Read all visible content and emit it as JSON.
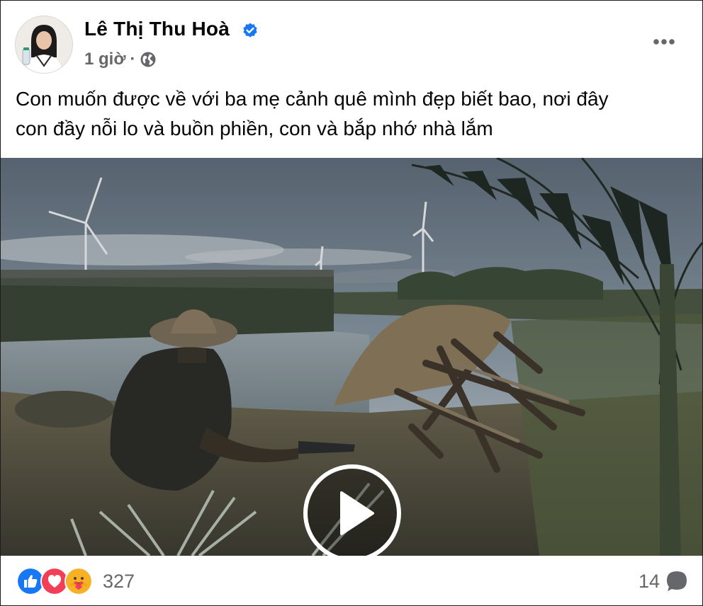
{
  "post": {
    "author": "Lê Thị Thu Hoà",
    "verified": true,
    "time": "1 giờ",
    "separator": "·",
    "audience_icon": "globe-icon",
    "more_icon": "more-horizontal-icon",
    "text_line1": "Con muốn được về với ba mẹ cảnh quê mình đẹp biết bao, nơi đây",
    "text_line2": "con đầy nỗi lo và buồn phiền, con và bắp nhớ nhà lắm"
  },
  "video": {
    "play_icon": "play-icon"
  },
  "footer": {
    "reaction_icons": [
      "like-icon",
      "love-icon",
      "care-icon"
    ],
    "reaction_count": "327",
    "comment_count": "14",
    "comment_icon": "comment-bubble-icon"
  },
  "colors": {
    "verified_blue": "#1877f2",
    "like_blue": "#1877f2",
    "love_red": "#f33e58",
    "care_yellow": "#f7b125",
    "secondary_text": "#65676b"
  }
}
